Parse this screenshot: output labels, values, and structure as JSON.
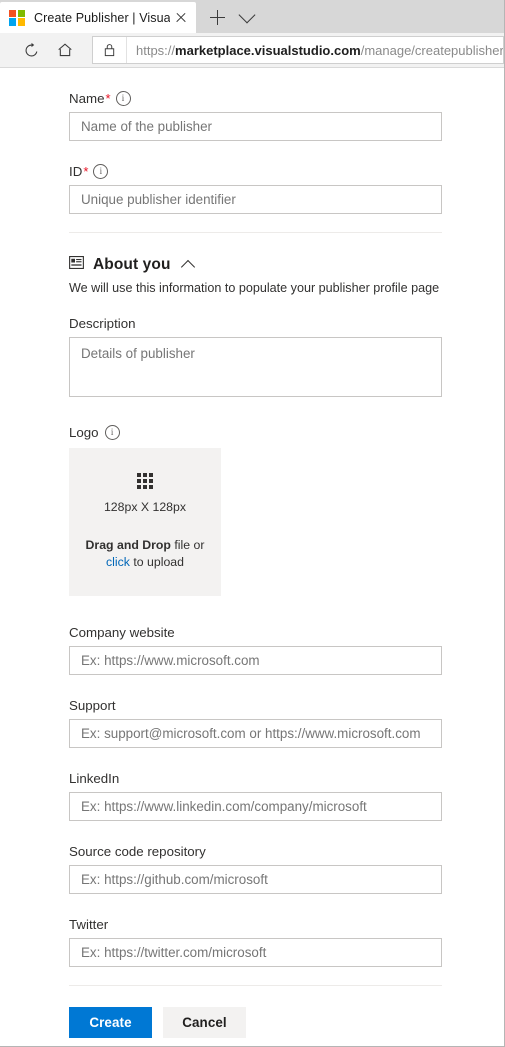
{
  "browser": {
    "tab": {
      "title": "Create Publisher | Visua",
      "favicon_name": "microsoft-logo-icon",
      "favicon_colors": [
        "#f25022",
        "#7fba00",
        "#00a4ef",
        "#ffb900"
      ],
      "close_label": "Close tab"
    },
    "new_tab_label": "New tab",
    "tab_list_label": "Tab actions menu",
    "toolbar": {
      "reload_label": "Refresh",
      "home_label": "Home",
      "lock_label": "Site information"
    },
    "address_bar": {
      "scheme": "https://",
      "domain": "marketplace.visualstudio.com",
      "path": "/manage/createpublisher",
      "full_url": "https://marketplace.visualstudio.com/manage/createpublisher"
    }
  },
  "form": {
    "name": {
      "label": "Name",
      "required_marker": "*",
      "info_glyph": "i",
      "placeholder": "Name of the publisher",
      "value": ""
    },
    "id": {
      "label": "ID",
      "required_marker": "*",
      "info_glyph": "i",
      "placeholder": "Unique publisher identifier",
      "value": ""
    },
    "about_section": {
      "icon_name": "id-card-icon",
      "title": "About you",
      "collapse_icon": "chevron-up-icon",
      "subtitle": "We will use this information to populate your publisher profile page"
    },
    "description": {
      "label": "Description",
      "placeholder": "Details of publisher",
      "value": ""
    },
    "logo": {
      "label": "Logo",
      "info_glyph": "i",
      "grid_icon_name": "image-grid-icon",
      "dimensions": "128px X 128px",
      "drag_strong": "Drag and Drop",
      "drag_rest": " file or",
      "link_text": "click",
      "link_rest": " to upload"
    },
    "company_website": {
      "label": "Company website",
      "placeholder": "Ex: https://www.microsoft.com",
      "value": ""
    },
    "support": {
      "label": "Support",
      "placeholder": "Ex: support@microsoft.com or https://www.microsoft.com",
      "value": ""
    },
    "linkedin": {
      "label": "LinkedIn",
      "placeholder": "Ex: https://www.linkedin.com/company/microsoft",
      "value": ""
    },
    "source_repo": {
      "label": "Source code repository",
      "placeholder": "Ex: https://github.com/microsoft",
      "value": ""
    },
    "twitter": {
      "label": "Twitter",
      "placeholder": "Ex: https://twitter.com/microsoft",
      "value": ""
    },
    "actions": {
      "create_label": "Create",
      "cancel_label": "Cancel"
    }
  },
  "colors": {
    "primary": "#0078d4",
    "link": "#0067b8",
    "required": "#e81123",
    "dropzone_bg": "#f3f2f1"
  }
}
